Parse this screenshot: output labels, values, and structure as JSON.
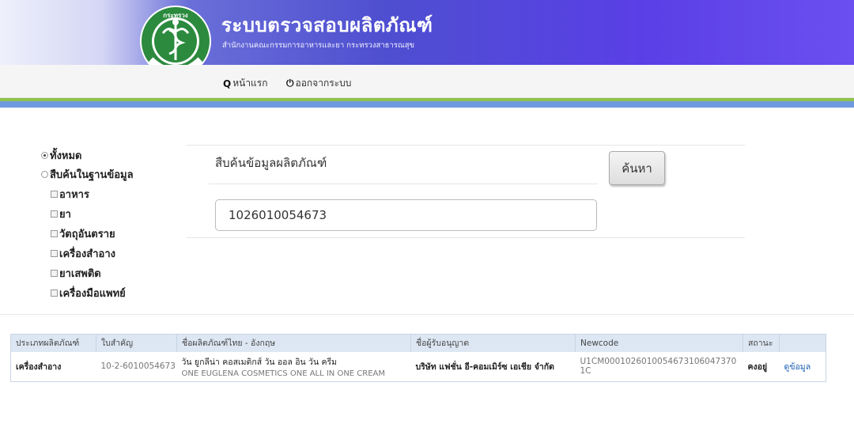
{
  "header": {
    "title": "ระบบตรวจสอบผลิตภัณฑ์",
    "subtitle": "สำนักงานคณะกรรมการอาหารและยา กระทรวงสาธารณสุข",
    "logo_text": "กระทรวงสาธารณสุข MINISTRY OF PUBLIC HEALTH"
  },
  "nav": {
    "home_label": "หน้าแรก",
    "logout_label": "ออกจากระบบ"
  },
  "filters": {
    "all_label": "ทั้งหมด",
    "db_label": "สืบค้นในฐานข้อมูล",
    "categories": [
      "อาหาร",
      "ยา",
      "วัตถุอันตราย",
      "เครื่องสำอาง",
      "ยาเสพติด",
      "เครื่องมือแพทย์"
    ]
  },
  "search": {
    "title": "สืบค้นข้อมูลผลิตภัณฑ์",
    "value": "1026010054673",
    "button_label": "ค้นหา"
  },
  "table": {
    "headers": [
      "ประเภทผลิตภัณฑ์",
      "ใบสำคัญ",
      "ชื่อผลิตภัณฑ์ไทย - อังกฤษ",
      "ชื่อผู้รับอนุญาต",
      "Newcode",
      "สถานะ",
      ""
    ],
    "rows": [
      {
        "type": "เครื่องสำอาง",
        "license": "10-2-6010054673",
        "name_th": "วัน ยูกลีน่า คอสเมติกส์ วัน ออล อิน วัน ครีม",
        "name_en": "ONE EUGLENA COSMETICS ONE ALL IN ONE CREAM",
        "licensee": "บริษัท แฟชั่น อี-คอมเมิร์ซ เอเชีย จำกัด",
        "newcode": "U1CM0001026010054673106047370​1C",
        "status": "คงอยู่",
        "action": "ดูข้อมูล"
      }
    ]
  }
}
